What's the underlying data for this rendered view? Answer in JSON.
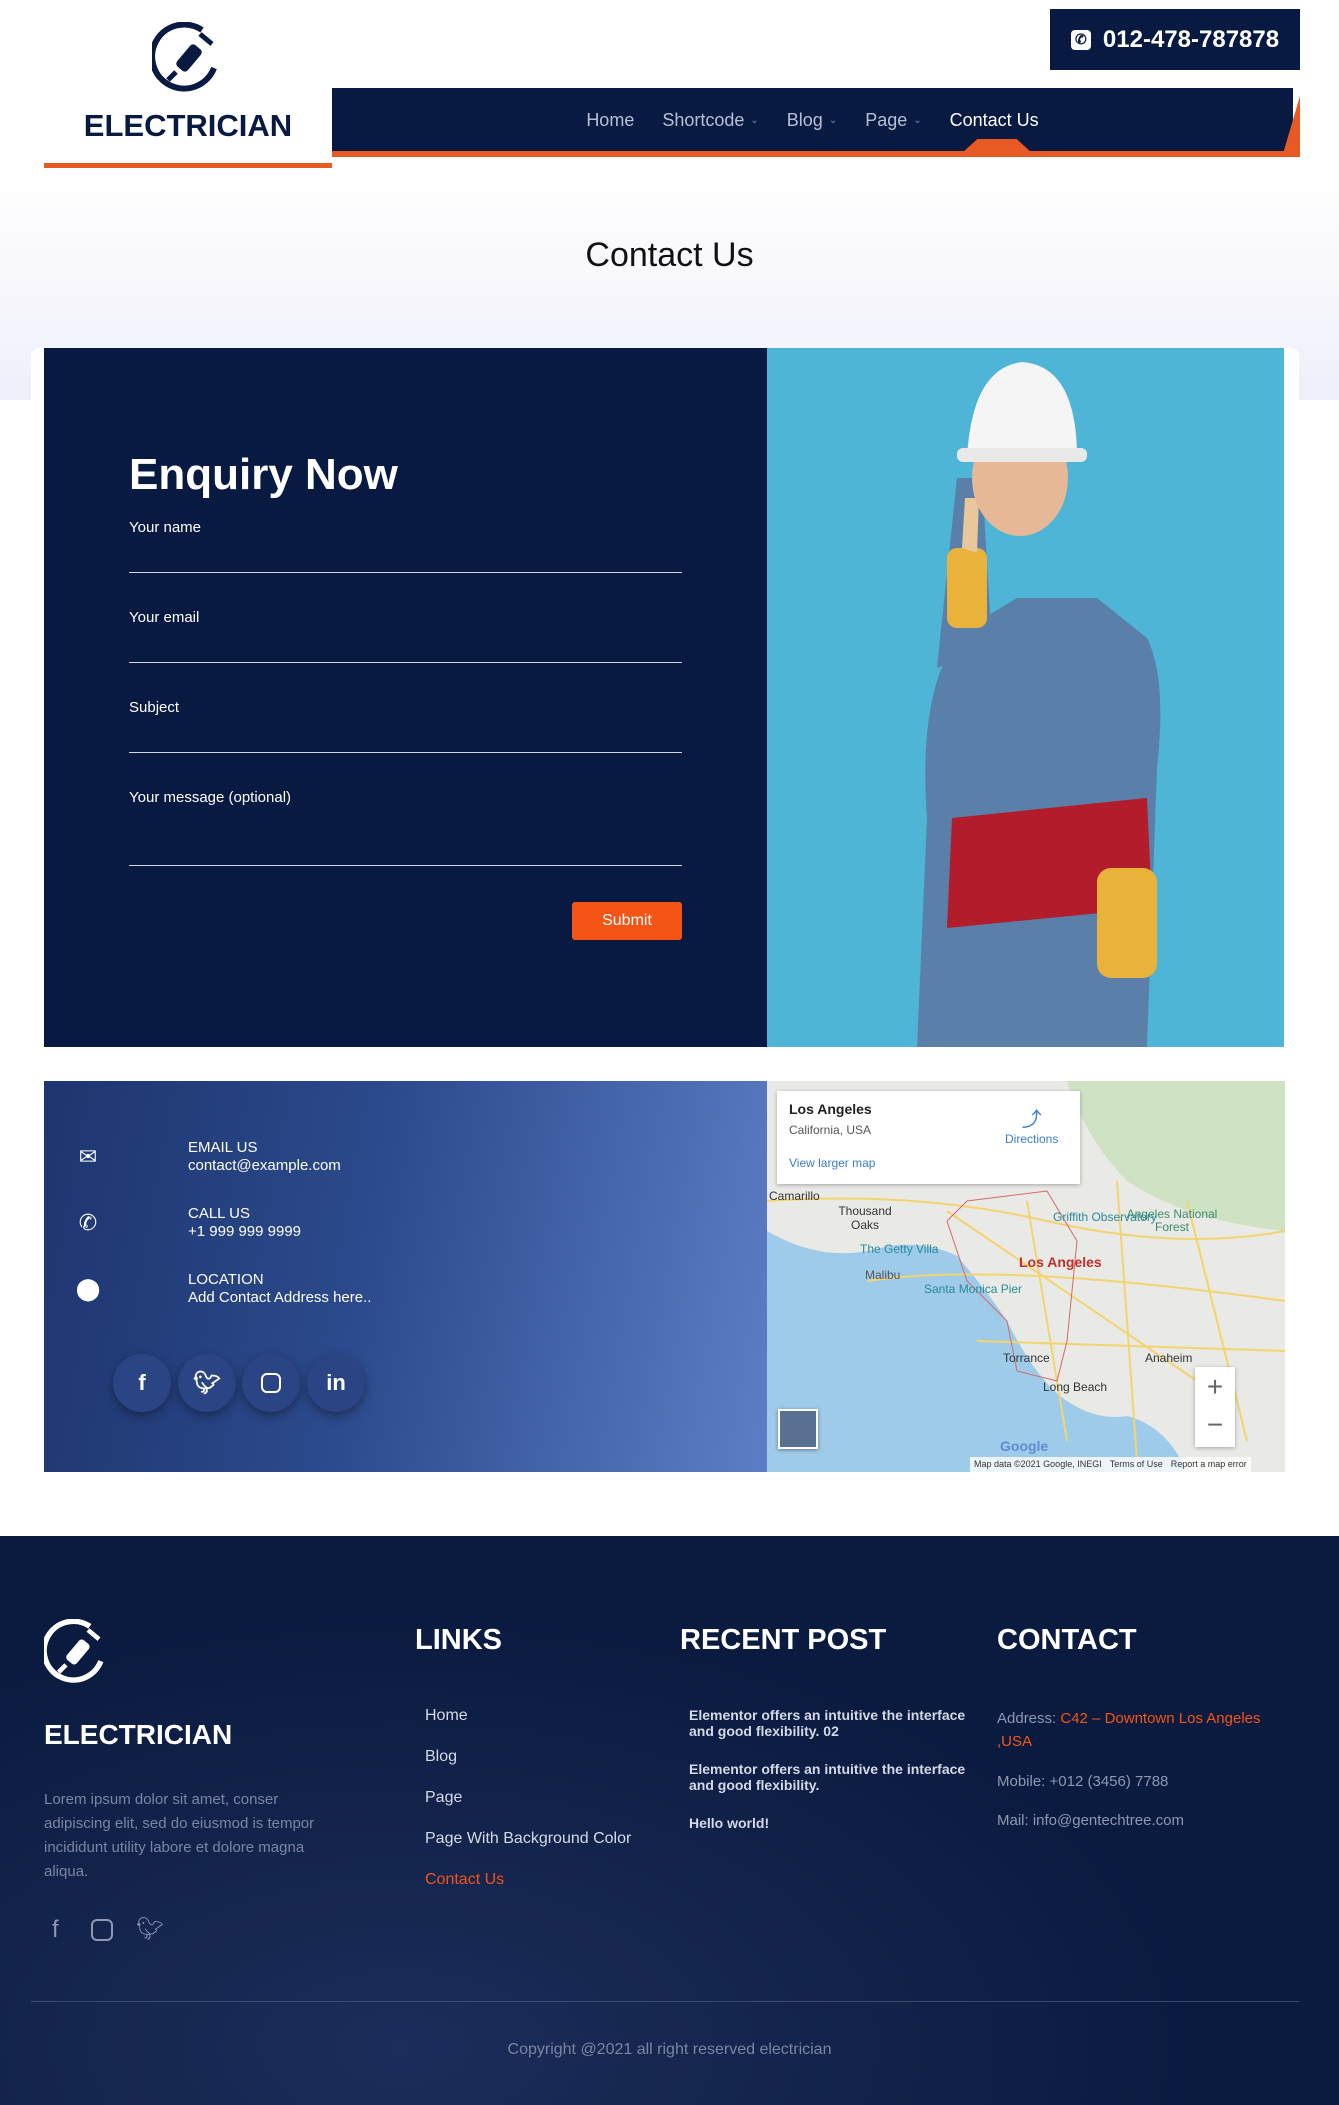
{
  "header": {
    "phone": "012-478-787878",
    "logo_text": "ELECTRICIAN",
    "nav": [
      {
        "label": "Home",
        "dropdown": false
      },
      {
        "label": "Shortcode",
        "dropdown": true
      },
      {
        "label": "Blog",
        "dropdown": true
      },
      {
        "label": "Page",
        "dropdown": true
      },
      {
        "label": "Contact Us",
        "dropdown": false,
        "active": true
      }
    ]
  },
  "hero": {
    "title": "Contact Us"
  },
  "enquiry": {
    "heading": "Enquiry Now",
    "fields": [
      "Your name",
      "Your email",
      "Subject",
      "Your message (optional)"
    ],
    "submit": "Submit"
  },
  "contact_info": {
    "items": [
      {
        "icon": "envelope-icon",
        "title": "EMAIL US",
        "value": "contact@example.com"
      },
      {
        "icon": "phone-icon",
        "title": "CALL US",
        "value": "+1 999 999 9999"
      },
      {
        "icon": "map-pin-icon",
        "title": "LOCATION",
        "value": "Add Contact Address here.."
      }
    ],
    "social": [
      "facebook",
      "twitter",
      "instagram",
      "linkedin"
    ]
  },
  "map": {
    "place": "Los Angeles",
    "region": "California, USA",
    "directions": "Directions",
    "larger": "View larger map",
    "labels": [
      "Angeles National Forest",
      "Camarillo",
      "Thousand Oaks",
      "Griffith Observatory",
      "The Getty Villa",
      "Los Angeles",
      "Malibu",
      "Santa Monica Pier",
      "Torrance",
      "Anaheim",
      "Long Beach"
    ],
    "attribution": "Map data ©2021 Google, INEGI",
    "terms": "Terms of Use",
    "report": "Report a map error",
    "google": "Google"
  },
  "footer": {
    "logo_text": "ELECTRICIAN",
    "about": "Lorem ipsum dolor sit amet, conser adipiscing elit, sed do eiusmod is tempor incididunt utility labore et dolore magna aliqua.",
    "links_title": "LINKS",
    "links": [
      "Home",
      "Blog",
      "Page",
      "Page With Background Color",
      "Contact Us"
    ],
    "recent_title": "RECENT POST",
    "posts": [
      "Elementor offers an intuitive the interface and good flexibility. 02",
      "Elementor offers an intuitive the interface and good flexibility.",
      "Hello world!"
    ],
    "contact_title": "CONTACT",
    "address_label": "Address: ",
    "address": "C42 – Downtown Los Angeles ,USA",
    "mobile": "Mobile: +012 (3456) 7788",
    "mail": "Mail: info@gentechtree.com",
    "copyright": "Copyright @2021 all right reserved electrician"
  },
  "colors": {
    "navy": "#081a42",
    "accent": "#f45517"
  }
}
